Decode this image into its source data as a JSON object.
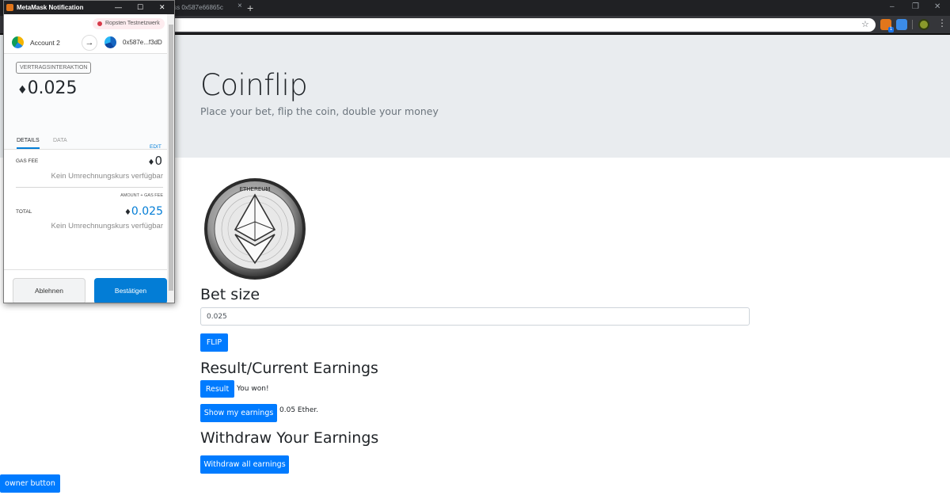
{
  "browser": {
    "tab_title": "ress 0x587e66865c",
    "tab_close": "×",
    "new_tab": "+",
    "star": "☆",
    "ext_badge": "1",
    "menu": "⋮",
    "win_minimize": "–",
    "win_restore": "❐",
    "win_close": "✕"
  },
  "page": {
    "title": "Coinflip",
    "lead": "Place your bet, flip the coin, double your money",
    "bet_heading": "Bet size",
    "bet_value": "0.025",
    "flip_label": "FLIP",
    "result_heading": "Result/Current Earnings",
    "result_button": "Result",
    "result_text": "You won!",
    "earnings_button": "Show my earnings",
    "earnings_text": "0.05 Ether.",
    "withdraw_heading": "Withdraw Your Earnings",
    "withdraw_button": "Withdraw all earnings",
    "owner_button": "owner button"
  },
  "metamask": {
    "window_title": "MetaMask Notification",
    "ctl_minimize": "—",
    "ctl_maximize": "☐",
    "ctl_close": "✕",
    "network": "Ropsten Testnetzwerk",
    "account_name": "Account 2",
    "arrow": "→",
    "to_address": "0x587e...f3dD",
    "interaction_tag": "VERTRAGSINTERAKTION",
    "amount": "0.025",
    "tab_details": "DETAILS",
    "tab_data": "DATA",
    "edit": "EDIT",
    "gas_fee_label": "GAS FEE",
    "gas_fee_value": "0",
    "no_rate": "Kein Umrechnungskurs verfügbar",
    "amount_gas_label": "AMOUNT + GAS FEE",
    "total_label": "TOTAL",
    "total_value": "0.025",
    "reject": "Ablehnen",
    "confirm": "Bestätigen",
    "eth_symbol": "♦",
    "coin_text": "ETHEREUM"
  }
}
